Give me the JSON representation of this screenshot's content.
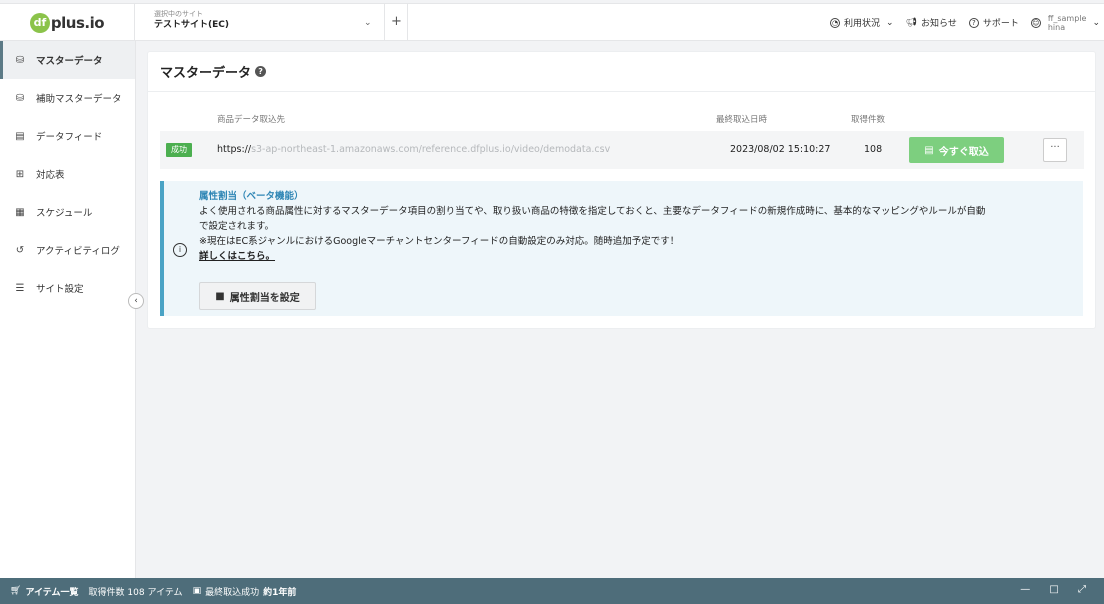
{
  "header": {
    "logo_mark": "df",
    "logo_text": "plus.io",
    "site_caption": "選択中のサイト",
    "site_name": "テストサイト(EC)",
    "add_label": "+",
    "usage_label": "利用状況",
    "notice_label": "お知らせ",
    "support_label": "サポート",
    "user_name": "ff_sample",
    "user_sub": "hina"
  },
  "sidebar": {
    "items": [
      {
        "label": "マスターデータ",
        "icon": "database-icon",
        "glyph": "⛁"
      },
      {
        "label": "補助マスターデータ",
        "icon": "database-plus-icon",
        "glyph": "⛁"
      },
      {
        "label": "データフィード",
        "icon": "file-icon",
        "glyph": "▤"
      },
      {
        "label": "対応表",
        "icon": "table-icon",
        "glyph": "⊞"
      },
      {
        "label": "スケジュール",
        "icon": "calendar-icon",
        "glyph": "▦"
      },
      {
        "label": "アクティビティログ",
        "icon": "history-icon",
        "glyph": "↺"
      },
      {
        "label": "サイト設定",
        "icon": "sliders-icon",
        "glyph": "☰"
      }
    ],
    "collapse_glyph": "‹"
  },
  "main": {
    "title": "マスターデータ",
    "help_glyph": "?",
    "columns": {
      "source": "商品データ取込先",
      "last_import": "最終取込日時",
      "count": "取得件数"
    },
    "row": {
      "status": "成功",
      "url_prefix": "https://",
      "url_rest": "s3-ap-northeast-1.amazonaws.com/reference.dfplus.io/video/demodata.csv",
      "date": "2023/08/02 15:10:27",
      "count": "108",
      "import_label": "今すぐ取込",
      "more_label": "···"
    },
    "info": {
      "title": "属性割当（ベータ機能）",
      "line1": "よく使用される商品属性に対するマスターデータ項目の割り当てや、取り扱い商品の特徴を指定しておくと、主要なデータフィードの新規作成時に、基本的なマッピングやルールが自動",
      "line2": "で設定されます。",
      "line3": "※現在はEC系ジャンルにおけるGoogleマーチャントセンターフィードの自動設定のみ対応。随時追加予定です！",
      "link": "詳しくはこちら。",
      "button_label": "属性割当を設定"
    }
  },
  "footer": {
    "items_label": "アイテム一覧",
    "count_text": "取得件数 108 アイテム",
    "last_success_label": "最終取込成功",
    "last_success_value": "約1年前",
    "controls": "— □ ⤢"
  },
  "colors": {
    "accent_green": "#7dcf7f",
    "success_badge": "#4caf50",
    "info_blue": "#2f86b5",
    "footer_bg": "#4e6d7a"
  }
}
